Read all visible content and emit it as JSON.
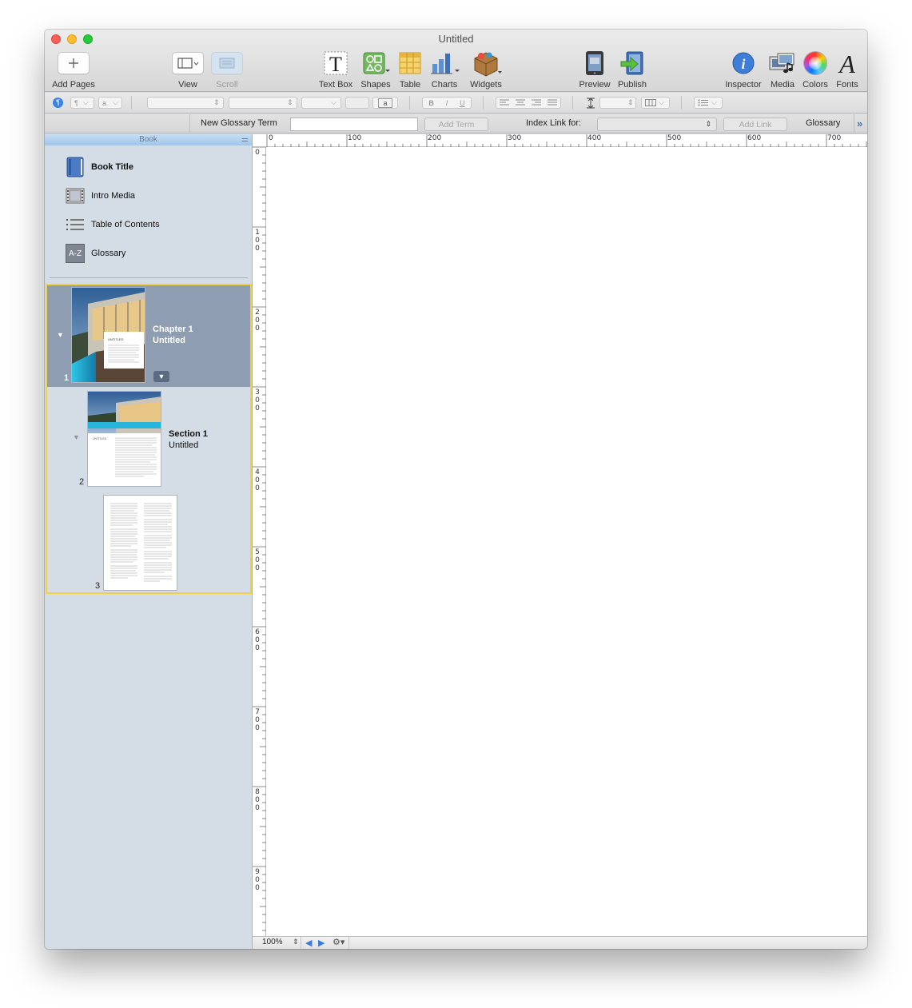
{
  "window": {
    "title": "Untitled"
  },
  "toolbar": {
    "add_pages": "Add Pages",
    "view": "View",
    "scroll": "Scroll",
    "text_box": "Text Box",
    "shapes": "Shapes",
    "table": "Table",
    "charts": "Charts",
    "widgets": "Widgets",
    "preview": "Preview",
    "publish": "Publish",
    "inspector": "Inspector",
    "media": "Media",
    "colors": "Colors",
    "fonts": "Fonts"
  },
  "format_bar": {
    "paragraph_symbol": "¶",
    "char_style": "a",
    "text_box_sample": "a",
    "bold": "B",
    "italic": "I",
    "underline": "U"
  },
  "glossary_bar": {
    "new_term_label": "New Glossary Term",
    "new_term_value": "",
    "add_term": "Add Term",
    "index_link_label": "Index Link for:",
    "add_link": "Add Link",
    "glossary": "Glossary"
  },
  "sidebar": {
    "header": "Book",
    "items": [
      {
        "label": "Book Title",
        "icon": "book-icon"
      },
      {
        "label": "Intro Media",
        "icon": "film-icon"
      },
      {
        "label": "Table of Contents",
        "icon": "list-icon"
      },
      {
        "label": "Glossary",
        "icon": "az-icon",
        "icon_text": "A-Z"
      }
    ],
    "chapter": {
      "title": "Chapter 1",
      "subtitle": "Untitled",
      "page": "1",
      "thumb_heading": "UNTITLED"
    },
    "section": {
      "title": "Section 1",
      "subtitle": "Untitled",
      "page": "2",
      "thumb_heading": "UNTITLED"
    },
    "page3": {
      "page": "3"
    }
  },
  "ruler": {
    "horizontal": [
      "0",
      "100",
      "200",
      "300",
      "400",
      "500",
      "600",
      "700"
    ],
    "vertical": [
      "0",
      "100",
      "200",
      "300",
      "400",
      "500",
      "600",
      "700",
      "800",
      "900"
    ]
  },
  "bottom_bar": {
    "zoom": "100%"
  },
  "colors": {
    "chapter_selected": "#8f9db3",
    "group_outline": "#f4cf3f",
    "sidebar_bg": "#d4dce5"
  }
}
